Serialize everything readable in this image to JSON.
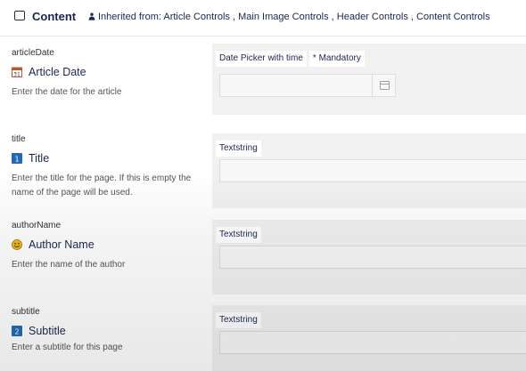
{
  "header": {
    "title": "Content",
    "inherited_text": "Inherited from: Article Controls , Main Image Controls , Header Controls , Content Controls"
  },
  "properties": [
    {
      "alias": "articleDate",
      "name": "Article Date",
      "icon": "calendar-icon",
      "icon_text": "31",
      "description": "Enter the date for the article",
      "editor": "Date Picker with time",
      "mandatory": "* Mandatory"
    },
    {
      "alias": "title",
      "name": "Title",
      "icon": "number-1-icon",
      "icon_text": "1",
      "description": "Enter the title for the page. If this is empty the name of the page will be used.",
      "editor": "Textstring"
    },
    {
      "alias": "authorName",
      "name": "Author Name",
      "icon": "smiley-icon",
      "description": "Enter the name of the author",
      "editor": "Textstring"
    },
    {
      "alias": "subtitle",
      "name": "Subtitle",
      "icon": "number-2-icon",
      "icon_text": "2",
      "description": "Enter a subtitle for this page",
      "editor": "Textstring"
    }
  ],
  "colors": {
    "text": "#1b264f",
    "editor_bg": "#f1f1f1",
    "number_badge": "#1f6bb3",
    "smiley": "#f1b51c"
  }
}
